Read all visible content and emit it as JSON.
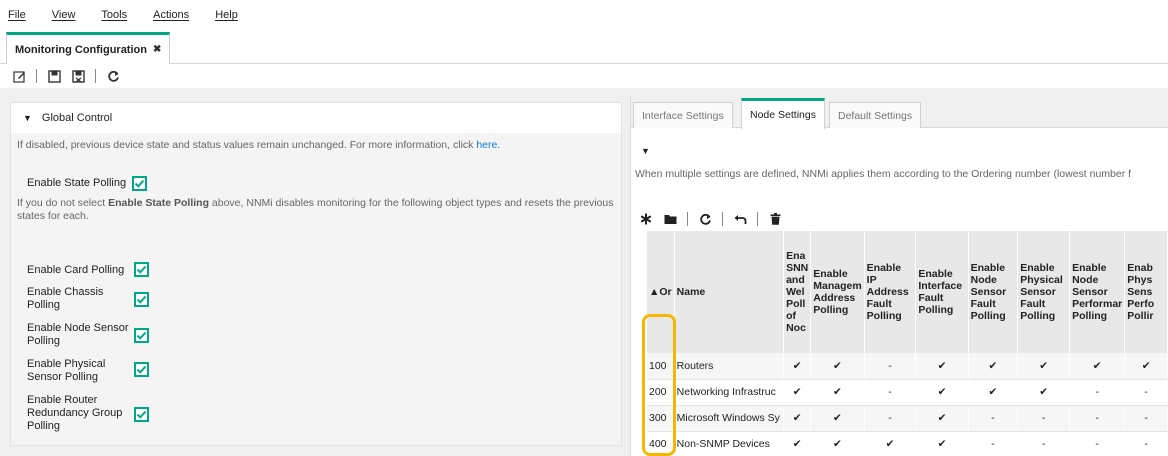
{
  "menu": [
    "File",
    "View",
    "Tools",
    "Actions",
    "Help"
  ],
  "doc_tab": {
    "label": "Monitoring Configuration",
    "close": "✖"
  },
  "toolbar_icons": [
    "edit-icon",
    "save-icon",
    "save-close-icon",
    "refresh-icon"
  ],
  "global_control": {
    "title": "Global Control",
    "info_prefix": "If disabled, previous device state and status values remain unchanged. For more information, click ",
    "info_link": "here",
    "info_suffix": ".",
    "state_polling_label": "Enable State Polling",
    "state_polling_checked": true,
    "warning_prefix": "If you do not select ",
    "warning_bold": "Enable State Polling",
    "warning_suffix": " above, NNMi disables monitoring for the following object types and resets the previous states for each.",
    "options": [
      {
        "label": "Enable Card Polling",
        "checked": true
      },
      {
        "label": "Enable Chassis Polling",
        "checked": true
      },
      {
        "label": "Enable Node Sensor Polling",
        "checked": true
      },
      {
        "label": "Enable Physical Sensor Polling",
        "checked": true
      },
      {
        "label": "Enable Router Redundancy Group Polling",
        "checked": true
      }
    ]
  },
  "right": {
    "tabs": [
      "Interface Settings",
      "Node Settings",
      "Default Settings"
    ],
    "active_tab": "Node Settings",
    "info": "When multiple settings are defined, NNMi applies them according to the Ordering number (lowest number f",
    "table_toolbar_icons": [
      "new-icon",
      "open-icon",
      "refresh-icon",
      "undo-icon",
      "delete-icon"
    ],
    "columns": [
      "▲Or",
      "Name",
      "Ena SNN and Wel Poll of Noc",
      "Enable Managem Address Polling",
      "Enable IP Address Fault Polling",
      "Enable Interface Fault Polling",
      "Enable Node Sensor Fault Polling",
      "Enable Physical Sensor Fault Polling",
      "Enable Node Sensor Performar Polling",
      "Enab Phys Sens Perfo Pollir"
    ],
    "rows": [
      [
        "100",
        "Routers",
        "✔",
        "✔",
        "-",
        "✔",
        "✔",
        "✔",
        "✔",
        "✔"
      ],
      [
        "200",
        "Networking Infrastruc",
        "✔",
        "✔",
        "-",
        "✔",
        "✔",
        "✔",
        "-",
        "-"
      ],
      [
        "300",
        "Microsoft Windows Sy",
        "✔",
        "✔",
        "-",
        "✔",
        "-",
        "-",
        "-",
        "-"
      ],
      [
        "400",
        "Non-SNMP Devices",
        "✔",
        "✔",
        "✔",
        "✔",
        "-",
        "-",
        "-",
        "-"
      ]
    ]
  },
  "colors": {
    "accent": "#01a982",
    "highlight": "#f5b800",
    "link": "#0a7bd6"
  }
}
